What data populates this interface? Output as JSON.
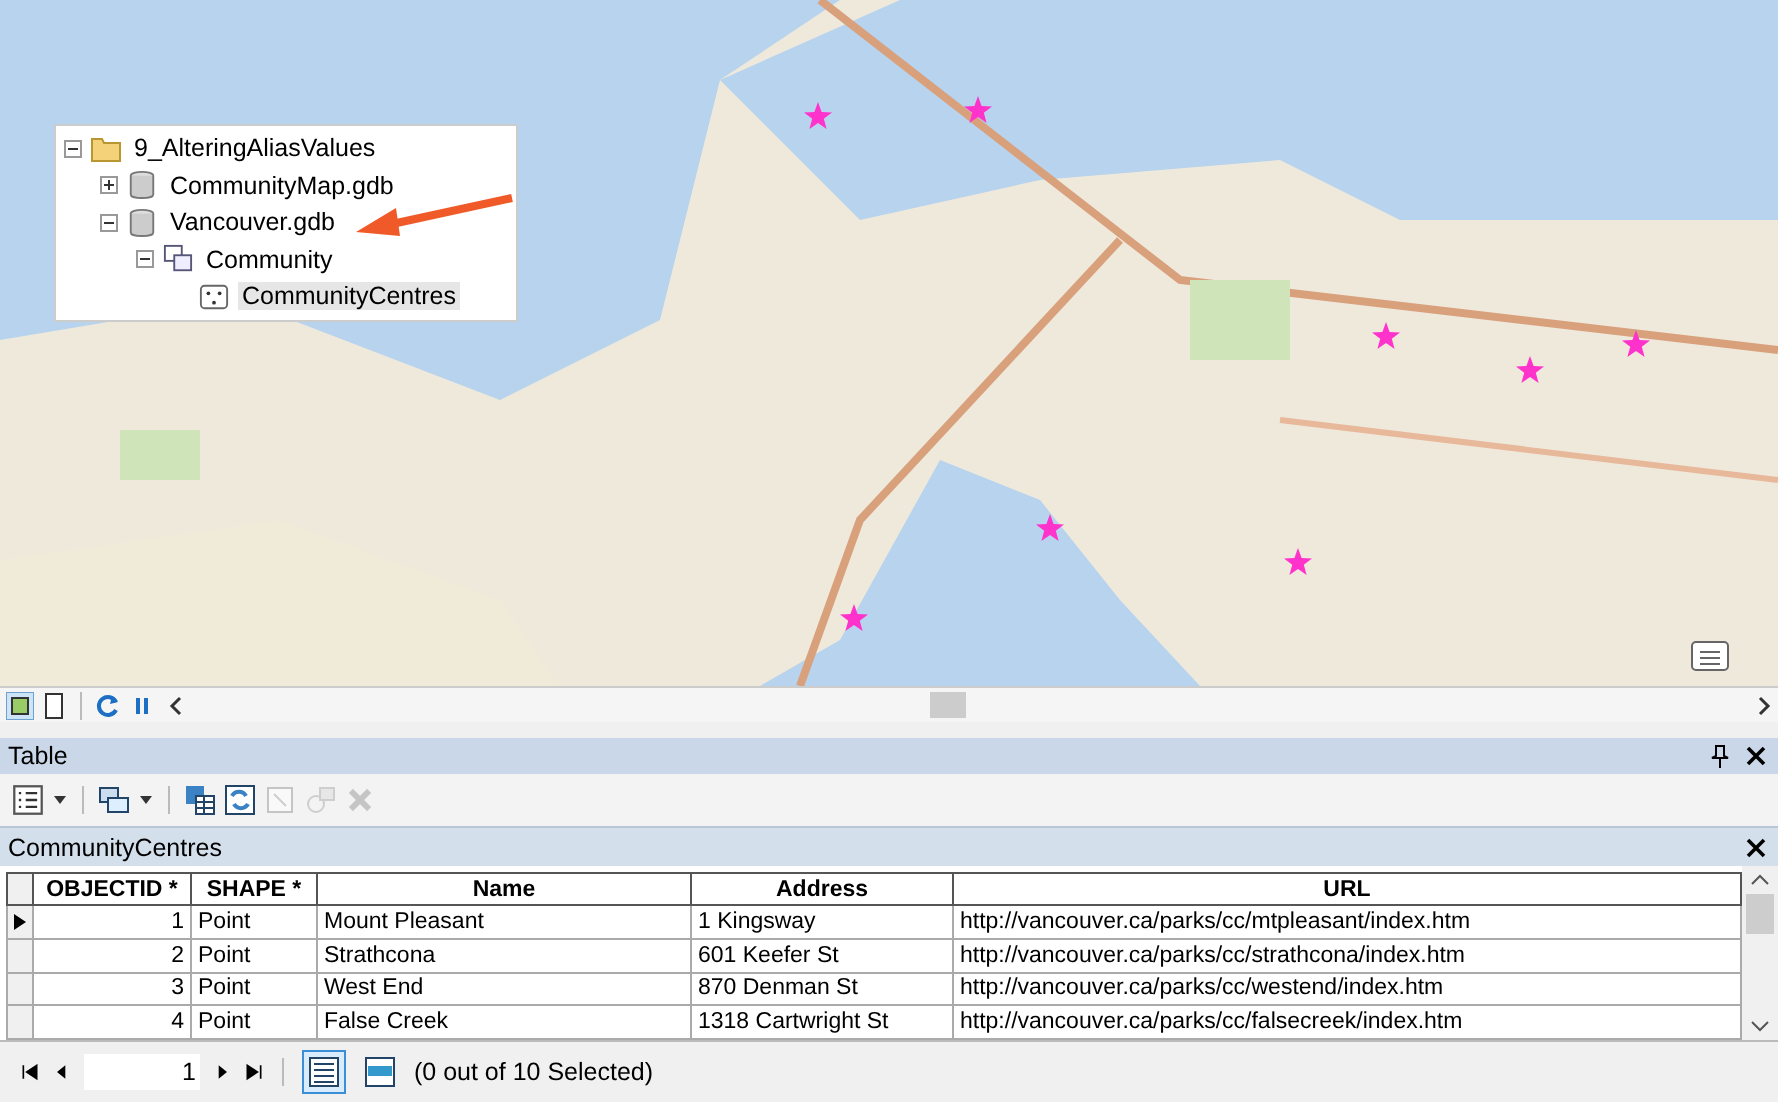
{
  "catalog_tree": [
    {
      "label": "9_AlteringAliasValues",
      "kind": "folder",
      "expanded": true,
      "selected": false,
      "children": [
        {
          "label": "CommunityMap.gdb",
          "kind": "database",
          "expanded": false,
          "selected": false
        },
        {
          "label": "Vancouver.gdb",
          "kind": "database",
          "expanded": true,
          "selected": false,
          "children": [
            {
              "label": "Community",
              "kind": "dataset",
              "expanded": true,
              "selected": false,
              "children": [
                {
                  "label": "CommunityCentres",
                  "kind": "points",
                  "selected": true
                }
              ]
            }
          ]
        }
      ]
    }
  ],
  "table_window": {
    "title": "Table",
    "layer_tab": "CommunityCentres",
    "columns": [
      "OBJECTID *",
      "SHAPE *",
      "Name",
      "Address",
      "URL"
    ],
    "rows": [
      {
        "current": true,
        "cells": [
          "1",
          "Point",
          "Mount Pleasant",
          "1 Kingsway",
          "http://vancouver.ca/parks/cc/mtpleasant/index.htm"
        ]
      },
      {
        "current": false,
        "cells": [
          "2",
          "Point",
          "Strathcona",
          "601 Keefer St",
          "http://vancouver.ca/parks/cc/strathcona/index.htm"
        ]
      },
      {
        "current": false,
        "cells": [
          "3",
          "Point",
          "West End",
          "870 Denman St",
          "http://vancouver.ca/parks/cc/westend/index.htm"
        ]
      },
      {
        "current": false,
        "cells": [
          "4",
          "Point",
          "False Creek",
          "1318 Cartwright St",
          "http://vancouver.ca/parks/cc/falsecreek/index.htm"
        ]
      }
    ],
    "record": "1",
    "views": [
      {
        "selected": true
      },
      {
        "selected": false
      }
    ],
    "status": "(0 out of 10 Selected)"
  }
}
